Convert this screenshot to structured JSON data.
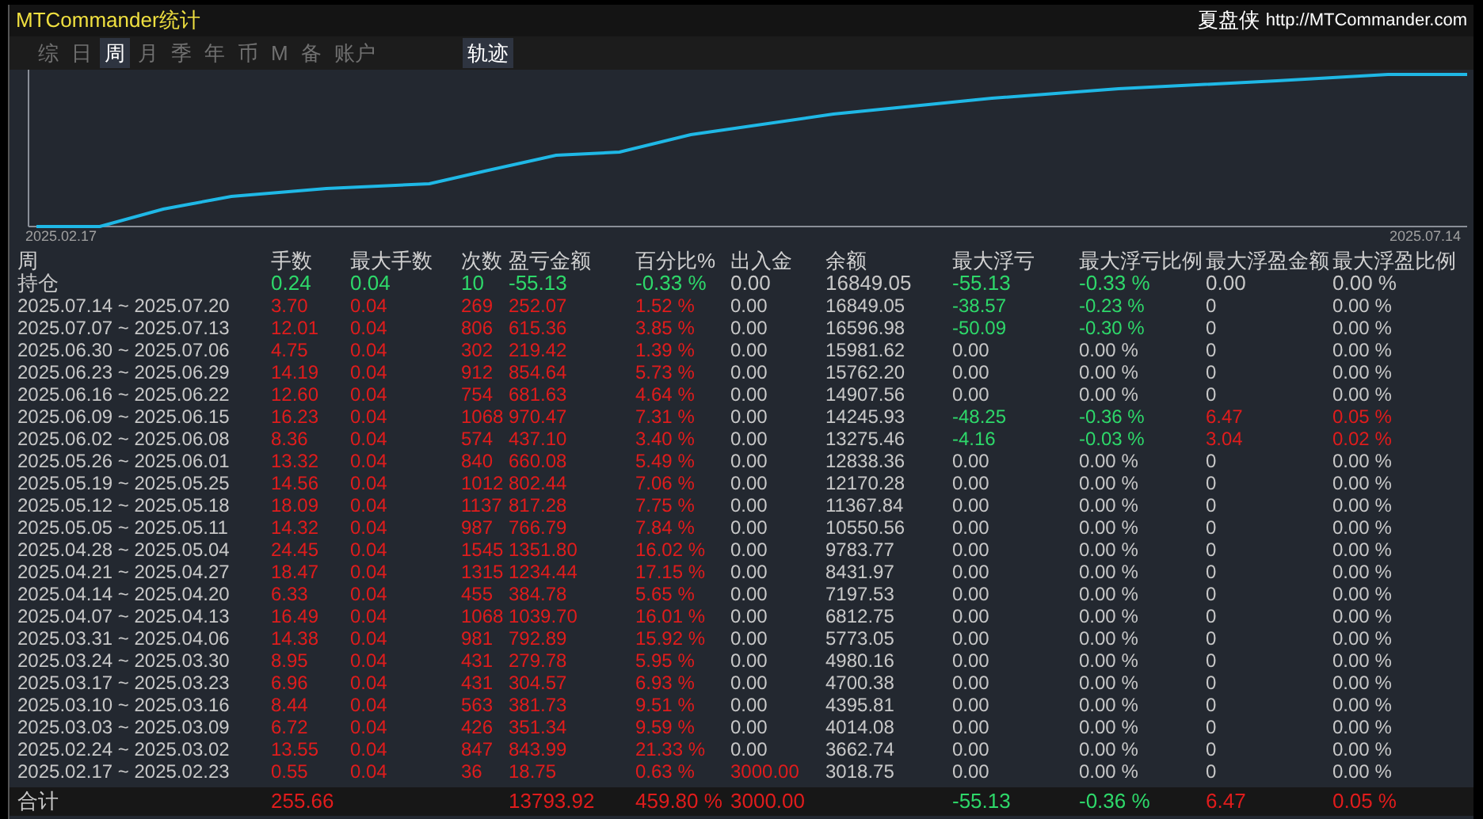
{
  "title": "MTCommander统计",
  "brand": {
    "name": "夏盘侠",
    "url": "http://MTCommander.com"
  },
  "tabs": [
    {
      "label": "综",
      "selected": false
    },
    {
      "label": "日",
      "selected": false
    },
    {
      "label": "周",
      "selected": true
    },
    {
      "label": "月",
      "selected": false
    },
    {
      "label": "季",
      "selected": false
    },
    {
      "label": "年",
      "selected": false
    },
    {
      "label": "币",
      "selected": false
    },
    {
      "label": "M",
      "selected": false
    },
    {
      "label": "备",
      "selected": false
    },
    {
      "label": "账户",
      "selected": false
    }
  ],
  "track_button": {
    "label": "轨迹",
    "on": true
  },
  "chart": {
    "start_label": "2025.02.17",
    "end_label": "2025.07.14"
  },
  "table": {
    "columns": [
      "周",
      "手数",
      "最大手数",
      "次数",
      "盈亏金额",
      "百分比%",
      "出入金",
      "余额",
      "最大浮亏",
      "最大浮亏比例",
      "最大浮盈金额",
      "最大浮盈比例"
    ],
    "rows": [
      [
        {
          "text": "持仓",
          "color": "#c8c8c8"
        },
        {
          "text": "0.24",
          "color": "#2ed86a"
        },
        {
          "text": "0.04",
          "color": "#2ed86a"
        },
        {
          "text": "10",
          "color": "#2ed86a"
        },
        {
          "text": "-55.13",
          "color": "#2ed86a"
        },
        {
          "text": "-0.33 %",
          "color": "#2ed86a"
        },
        {
          "text": "0.00",
          "color": "#c8c8c8"
        },
        {
          "text": "16849.05",
          "color": "#c8c8c8"
        },
        {
          "text": "-55.13",
          "color": "#2ed86a"
        },
        {
          "text": "-0.33 %",
          "color": "#2ed86a"
        },
        {
          "text": "0.00",
          "color": "#c8c8c8"
        },
        {
          "text": "0.00 %",
          "color": "#c8c8c8"
        }
      ],
      [
        {
          "text": "2025.07.14 ~ 2025.07.20",
          "color": "#c8c8c8"
        },
        {
          "text": "3.70",
          "color": "#e01c1c"
        },
        {
          "text": "0.04",
          "color": "#e01c1c"
        },
        {
          "text": "269",
          "color": "#e01c1c"
        },
        {
          "text": "252.07",
          "color": "#e01c1c"
        },
        {
          "text": "1.52 %",
          "color": "#e01c1c"
        },
        {
          "text": "0.00",
          "color": "#c8c8c8"
        },
        {
          "text": "16849.05",
          "color": "#c8c8c8"
        },
        {
          "text": "-38.57",
          "color": "#2ed86a"
        },
        {
          "text": "-0.23 %",
          "color": "#2ed86a"
        },
        {
          "text": "0",
          "color": "#c8c8c8"
        },
        {
          "text": "0.00 %",
          "color": "#c8c8c8"
        }
      ],
      [
        {
          "text": "2025.07.07 ~ 2025.07.13",
          "color": "#c8c8c8"
        },
        {
          "text": "12.01",
          "color": "#e01c1c"
        },
        {
          "text": "0.04",
          "color": "#e01c1c"
        },
        {
          "text": "806",
          "color": "#e01c1c"
        },
        {
          "text": "615.36",
          "color": "#e01c1c"
        },
        {
          "text": "3.85 %",
          "color": "#e01c1c"
        },
        {
          "text": "0.00",
          "color": "#c8c8c8"
        },
        {
          "text": "16596.98",
          "color": "#c8c8c8"
        },
        {
          "text": "-50.09",
          "color": "#2ed86a"
        },
        {
          "text": "-0.30 %",
          "color": "#2ed86a"
        },
        {
          "text": "0",
          "color": "#c8c8c8"
        },
        {
          "text": "0.00 %",
          "color": "#c8c8c8"
        }
      ],
      [
        {
          "text": "2025.06.30 ~ 2025.07.06",
          "color": "#c8c8c8"
        },
        {
          "text": "4.75",
          "color": "#e01c1c"
        },
        {
          "text": "0.04",
          "color": "#e01c1c"
        },
        {
          "text": "302",
          "color": "#e01c1c"
        },
        {
          "text": "219.42",
          "color": "#e01c1c"
        },
        {
          "text": "1.39 %",
          "color": "#e01c1c"
        },
        {
          "text": "0.00",
          "color": "#c8c8c8"
        },
        {
          "text": "15981.62",
          "color": "#c8c8c8"
        },
        {
          "text": "0.00",
          "color": "#c8c8c8"
        },
        {
          "text": "0.00 %",
          "color": "#c8c8c8"
        },
        {
          "text": "0",
          "color": "#c8c8c8"
        },
        {
          "text": "0.00 %",
          "color": "#c8c8c8"
        }
      ],
      [
        {
          "text": "2025.06.23 ~ 2025.06.29",
          "color": "#c8c8c8"
        },
        {
          "text": "14.19",
          "color": "#e01c1c"
        },
        {
          "text": "0.04",
          "color": "#e01c1c"
        },
        {
          "text": "912",
          "color": "#e01c1c"
        },
        {
          "text": "854.64",
          "color": "#e01c1c"
        },
        {
          "text": "5.73 %",
          "color": "#e01c1c"
        },
        {
          "text": "0.00",
          "color": "#c8c8c8"
        },
        {
          "text": "15762.20",
          "color": "#c8c8c8"
        },
        {
          "text": "0.00",
          "color": "#c8c8c8"
        },
        {
          "text": "0.00 %",
          "color": "#c8c8c8"
        },
        {
          "text": "0",
          "color": "#c8c8c8"
        },
        {
          "text": "0.00 %",
          "color": "#c8c8c8"
        }
      ],
      [
        {
          "text": "2025.06.16 ~ 2025.06.22",
          "color": "#c8c8c8"
        },
        {
          "text": "12.60",
          "color": "#e01c1c"
        },
        {
          "text": "0.04",
          "color": "#e01c1c"
        },
        {
          "text": "754",
          "color": "#e01c1c"
        },
        {
          "text": "681.63",
          "color": "#e01c1c"
        },
        {
          "text": "4.64 %",
          "color": "#e01c1c"
        },
        {
          "text": "0.00",
          "color": "#c8c8c8"
        },
        {
          "text": "14907.56",
          "color": "#c8c8c8"
        },
        {
          "text": "0.00",
          "color": "#c8c8c8"
        },
        {
          "text": "0.00 %",
          "color": "#c8c8c8"
        },
        {
          "text": "0",
          "color": "#c8c8c8"
        },
        {
          "text": "0.00 %",
          "color": "#c8c8c8"
        }
      ],
      [
        {
          "text": "2025.06.09 ~ 2025.06.15",
          "color": "#c8c8c8"
        },
        {
          "text": "16.23",
          "color": "#e01c1c"
        },
        {
          "text": "0.04",
          "color": "#e01c1c"
        },
        {
          "text": "1068",
          "color": "#e01c1c"
        },
        {
          "text": "970.47",
          "color": "#e01c1c"
        },
        {
          "text": "7.31 %",
          "color": "#e01c1c"
        },
        {
          "text": "0.00",
          "color": "#c8c8c8"
        },
        {
          "text": "14245.93",
          "color": "#c8c8c8"
        },
        {
          "text": "-48.25",
          "color": "#2ed86a"
        },
        {
          "text": "-0.36 %",
          "color": "#2ed86a"
        },
        {
          "text": "6.47",
          "color": "#e01c1c"
        },
        {
          "text": "0.05 %",
          "color": "#e01c1c"
        }
      ],
      [
        {
          "text": "2025.06.02 ~ 2025.06.08",
          "color": "#c8c8c8"
        },
        {
          "text": "8.36",
          "color": "#e01c1c"
        },
        {
          "text": "0.04",
          "color": "#e01c1c"
        },
        {
          "text": "574",
          "color": "#e01c1c"
        },
        {
          "text": "437.10",
          "color": "#e01c1c"
        },
        {
          "text": "3.40 %",
          "color": "#e01c1c"
        },
        {
          "text": "0.00",
          "color": "#c8c8c8"
        },
        {
          "text": "13275.46",
          "color": "#c8c8c8"
        },
        {
          "text": "-4.16",
          "color": "#2ed86a"
        },
        {
          "text": "-0.03 %",
          "color": "#2ed86a"
        },
        {
          "text": "3.04",
          "color": "#e01c1c"
        },
        {
          "text": "0.02 %",
          "color": "#e01c1c"
        }
      ],
      [
        {
          "text": "2025.05.26 ~ 2025.06.01",
          "color": "#c8c8c8"
        },
        {
          "text": "13.32",
          "color": "#e01c1c"
        },
        {
          "text": "0.04",
          "color": "#e01c1c"
        },
        {
          "text": "840",
          "color": "#e01c1c"
        },
        {
          "text": "660.08",
          "color": "#e01c1c"
        },
        {
          "text": "5.49 %",
          "color": "#e01c1c"
        },
        {
          "text": "0.00",
          "color": "#c8c8c8"
        },
        {
          "text": "12838.36",
          "color": "#c8c8c8"
        },
        {
          "text": "0.00",
          "color": "#c8c8c8"
        },
        {
          "text": "0.00 %",
          "color": "#c8c8c8"
        },
        {
          "text": "0",
          "color": "#c8c8c8"
        },
        {
          "text": "0.00 %",
          "color": "#c8c8c8"
        }
      ],
      [
        {
          "text": "2025.05.19 ~ 2025.05.25",
          "color": "#c8c8c8"
        },
        {
          "text": "14.56",
          "color": "#e01c1c"
        },
        {
          "text": "0.04",
          "color": "#e01c1c"
        },
        {
          "text": "1012",
          "color": "#e01c1c"
        },
        {
          "text": "802.44",
          "color": "#e01c1c"
        },
        {
          "text": "7.06 %",
          "color": "#e01c1c"
        },
        {
          "text": "0.00",
          "color": "#c8c8c8"
        },
        {
          "text": "12170.28",
          "color": "#c8c8c8"
        },
        {
          "text": "0.00",
          "color": "#c8c8c8"
        },
        {
          "text": "0.00 %",
          "color": "#c8c8c8"
        },
        {
          "text": "0",
          "color": "#c8c8c8"
        },
        {
          "text": "0.00 %",
          "color": "#c8c8c8"
        }
      ],
      [
        {
          "text": "2025.05.12 ~ 2025.05.18",
          "color": "#c8c8c8"
        },
        {
          "text": "18.09",
          "color": "#e01c1c"
        },
        {
          "text": "0.04",
          "color": "#e01c1c"
        },
        {
          "text": "1137",
          "color": "#e01c1c"
        },
        {
          "text": "817.28",
          "color": "#e01c1c"
        },
        {
          "text": "7.75 %",
          "color": "#e01c1c"
        },
        {
          "text": "0.00",
          "color": "#c8c8c8"
        },
        {
          "text": "11367.84",
          "color": "#c8c8c8"
        },
        {
          "text": "0.00",
          "color": "#c8c8c8"
        },
        {
          "text": "0.00 %",
          "color": "#c8c8c8"
        },
        {
          "text": "0",
          "color": "#c8c8c8"
        },
        {
          "text": "0.00 %",
          "color": "#c8c8c8"
        }
      ],
      [
        {
          "text": "2025.05.05 ~ 2025.05.11",
          "color": "#c8c8c8"
        },
        {
          "text": "14.32",
          "color": "#e01c1c"
        },
        {
          "text": "0.04",
          "color": "#e01c1c"
        },
        {
          "text": "987",
          "color": "#e01c1c"
        },
        {
          "text": "766.79",
          "color": "#e01c1c"
        },
        {
          "text": "7.84 %",
          "color": "#e01c1c"
        },
        {
          "text": "0.00",
          "color": "#c8c8c8"
        },
        {
          "text": "10550.56",
          "color": "#c8c8c8"
        },
        {
          "text": "0.00",
          "color": "#c8c8c8"
        },
        {
          "text": "0.00 %",
          "color": "#c8c8c8"
        },
        {
          "text": "0",
          "color": "#c8c8c8"
        },
        {
          "text": "0.00 %",
          "color": "#c8c8c8"
        }
      ],
      [
        {
          "text": "2025.04.28 ~ 2025.05.04",
          "color": "#c8c8c8"
        },
        {
          "text": "24.45",
          "color": "#e01c1c"
        },
        {
          "text": "0.04",
          "color": "#e01c1c"
        },
        {
          "text": "1545",
          "color": "#e01c1c"
        },
        {
          "text": "1351.80",
          "color": "#e01c1c"
        },
        {
          "text": "16.02 %",
          "color": "#e01c1c"
        },
        {
          "text": "0.00",
          "color": "#c8c8c8"
        },
        {
          "text": "9783.77",
          "color": "#c8c8c8"
        },
        {
          "text": "0.00",
          "color": "#c8c8c8"
        },
        {
          "text": "0.00 %",
          "color": "#c8c8c8"
        },
        {
          "text": "0",
          "color": "#c8c8c8"
        },
        {
          "text": "0.00 %",
          "color": "#c8c8c8"
        }
      ],
      [
        {
          "text": "2025.04.21 ~ 2025.04.27",
          "color": "#c8c8c8"
        },
        {
          "text": "18.47",
          "color": "#e01c1c"
        },
        {
          "text": "0.04",
          "color": "#e01c1c"
        },
        {
          "text": "1315",
          "color": "#e01c1c"
        },
        {
          "text": "1234.44",
          "color": "#e01c1c"
        },
        {
          "text": "17.15 %",
          "color": "#e01c1c"
        },
        {
          "text": "0.00",
          "color": "#c8c8c8"
        },
        {
          "text": "8431.97",
          "color": "#c8c8c8"
        },
        {
          "text": "0.00",
          "color": "#c8c8c8"
        },
        {
          "text": "0.00 %",
          "color": "#c8c8c8"
        },
        {
          "text": "0",
          "color": "#c8c8c8"
        },
        {
          "text": "0.00 %",
          "color": "#c8c8c8"
        }
      ],
      [
        {
          "text": "2025.04.14 ~ 2025.04.20",
          "color": "#c8c8c8"
        },
        {
          "text": "6.33",
          "color": "#e01c1c"
        },
        {
          "text": "0.04",
          "color": "#e01c1c"
        },
        {
          "text": "455",
          "color": "#e01c1c"
        },
        {
          "text": "384.78",
          "color": "#e01c1c"
        },
        {
          "text": "5.65 %",
          "color": "#e01c1c"
        },
        {
          "text": "0.00",
          "color": "#c8c8c8"
        },
        {
          "text": "7197.53",
          "color": "#c8c8c8"
        },
        {
          "text": "0.00",
          "color": "#c8c8c8"
        },
        {
          "text": "0.00 %",
          "color": "#c8c8c8"
        },
        {
          "text": "0",
          "color": "#c8c8c8"
        },
        {
          "text": "0.00 %",
          "color": "#c8c8c8"
        }
      ],
      [
        {
          "text": "2025.04.07 ~ 2025.04.13",
          "color": "#c8c8c8"
        },
        {
          "text": "16.49",
          "color": "#e01c1c"
        },
        {
          "text": "0.04",
          "color": "#e01c1c"
        },
        {
          "text": "1068",
          "color": "#e01c1c"
        },
        {
          "text": "1039.70",
          "color": "#e01c1c"
        },
        {
          "text": "16.01 %",
          "color": "#e01c1c"
        },
        {
          "text": "0.00",
          "color": "#c8c8c8"
        },
        {
          "text": "6812.75",
          "color": "#c8c8c8"
        },
        {
          "text": "0.00",
          "color": "#c8c8c8"
        },
        {
          "text": "0.00 %",
          "color": "#c8c8c8"
        },
        {
          "text": "0",
          "color": "#c8c8c8"
        },
        {
          "text": "0.00 %",
          "color": "#c8c8c8"
        }
      ],
      [
        {
          "text": "2025.03.31 ~ 2025.04.06",
          "color": "#c8c8c8"
        },
        {
          "text": "14.38",
          "color": "#e01c1c"
        },
        {
          "text": "0.04",
          "color": "#e01c1c"
        },
        {
          "text": "981",
          "color": "#e01c1c"
        },
        {
          "text": "792.89",
          "color": "#e01c1c"
        },
        {
          "text": "15.92 %",
          "color": "#e01c1c"
        },
        {
          "text": "0.00",
          "color": "#c8c8c8"
        },
        {
          "text": "5773.05",
          "color": "#c8c8c8"
        },
        {
          "text": "0.00",
          "color": "#c8c8c8"
        },
        {
          "text": "0.00 %",
          "color": "#c8c8c8"
        },
        {
          "text": "0",
          "color": "#c8c8c8"
        },
        {
          "text": "0.00 %",
          "color": "#c8c8c8"
        }
      ],
      [
        {
          "text": "2025.03.24 ~ 2025.03.30",
          "color": "#c8c8c8"
        },
        {
          "text": "8.95",
          "color": "#e01c1c"
        },
        {
          "text": "0.04",
          "color": "#e01c1c"
        },
        {
          "text": "431",
          "color": "#e01c1c"
        },
        {
          "text": "279.78",
          "color": "#e01c1c"
        },
        {
          "text": "5.95 %",
          "color": "#e01c1c"
        },
        {
          "text": "0.00",
          "color": "#c8c8c8"
        },
        {
          "text": "4980.16",
          "color": "#c8c8c8"
        },
        {
          "text": "0.00",
          "color": "#c8c8c8"
        },
        {
          "text": "0.00 %",
          "color": "#c8c8c8"
        },
        {
          "text": "0",
          "color": "#c8c8c8"
        },
        {
          "text": "0.00 %",
          "color": "#c8c8c8"
        }
      ],
      [
        {
          "text": "2025.03.17 ~ 2025.03.23",
          "color": "#c8c8c8"
        },
        {
          "text": "6.96",
          "color": "#e01c1c"
        },
        {
          "text": "0.04",
          "color": "#e01c1c"
        },
        {
          "text": "431",
          "color": "#e01c1c"
        },
        {
          "text": "304.57",
          "color": "#e01c1c"
        },
        {
          "text": "6.93 %",
          "color": "#e01c1c"
        },
        {
          "text": "0.00",
          "color": "#c8c8c8"
        },
        {
          "text": "4700.38",
          "color": "#c8c8c8"
        },
        {
          "text": "0.00",
          "color": "#c8c8c8"
        },
        {
          "text": "0.00 %",
          "color": "#c8c8c8"
        },
        {
          "text": "0",
          "color": "#c8c8c8"
        },
        {
          "text": "0.00 %",
          "color": "#c8c8c8"
        }
      ],
      [
        {
          "text": "2025.03.10 ~ 2025.03.16",
          "color": "#c8c8c8"
        },
        {
          "text": "8.44",
          "color": "#e01c1c"
        },
        {
          "text": "0.04",
          "color": "#e01c1c"
        },
        {
          "text": "563",
          "color": "#e01c1c"
        },
        {
          "text": "381.73",
          "color": "#e01c1c"
        },
        {
          "text": "9.51 %",
          "color": "#e01c1c"
        },
        {
          "text": "0.00",
          "color": "#c8c8c8"
        },
        {
          "text": "4395.81",
          "color": "#c8c8c8"
        },
        {
          "text": "0.00",
          "color": "#c8c8c8"
        },
        {
          "text": "0.00 %",
          "color": "#c8c8c8"
        },
        {
          "text": "0",
          "color": "#c8c8c8"
        },
        {
          "text": "0.00 %",
          "color": "#c8c8c8"
        }
      ],
      [
        {
          "text": "2025.03.03 ~ 2025.03.09",
          "color": "#c8c8c8"
        },
        {
          "text": "6.72",
          "color": "#e01c1c"
        },
        {
          "text": "0.04",
          "color": "#e01c1c"
        },
        {
          "text": "426",
          "color": "#e01c1c"
        },
        {
          "text": "351.34",
          "color": "#e01c1c"
        },
        {
          "text": "9.59 %",
          "color": "#e01c1c"
        },
        {
          "text": "0.00",
          "color": "#c8c8c8"
        },
        {
          "text": "4014.08",
          "color": "#c8c8c8"
        },
        {
          "text": "0.00",
          "color": "#c8c8c8"
        },
        {
          "text": "0.00 %",
          "color": "#c8c8c8"
        },
        {
          "text": "0",
          "color": "#c8c8c8"
        },
        {
          "text": "0.00 %",
          "color": "#c8c8c8"
        }
      ],
      [
        {
          "text": "2025.02.24 ~ 2025.03.02",
          "color": "#c8c8c8"
        },
        {
          "text": "13.55",
          "color": "#e01c1c"
        },
        {
          "text": "0.04",
          "color": "#e01c1c"
        },
        {
          "text": "847",
          "color": "#e01c1c"
        },
        {
          "text": "843.99",
          "color": "#e01c1c"
        },
        {
          "text": "21.33 %",
          "color": "#e01c1c"
        },
        {
          "text": "0.00",
          "color": "#c8c8c8"
        },
        {
          "text": "3662.74",
          "color": "#c8c8c8"
        },
        {
          "text": "0.00",
          "color": "#c8c8c8"
        },
        {
          "text": "0.00 %",
          "color": "#c8c8c8"
        },
        {
          "text": "0",
          "color": "#c8c8c8"
        },
        {
          "text": "0.00 %",
          "color": "#c8c8c8"
        }
      ],
      [
        {
          "text": "2025.02.17 ~ 2025.02.23",
          "color": "#c8c8c8"
        },
        {
          "text": "0.55",
          "color": "#e01c1c"
        },
        {
          "text": "0.04",
          "color": "#e01c1c"
        },
        {
          "text": "36",
          "color": "#e01c1c"
        },
        {
          "text": "18.75",
          "color": "#e01c1c"
        },
        {
          "text": "0.63 %",
          "color": "#e01c1c"
        },
        {
          "text": "3000.00",
          "color": "#e01c1c"
        },
        {
          "text": "3018.75",
          "color": "#c8c8c8"
        },
        {
          "text": "0.00",
          "color": "#c8c8c8"
        },
        {
          "text": "0.00 %",
          "color": "#c8c8c8"
        },
        {
          "text": "0",
          "color": "#c8c8c8"
        },
        {
          "text": "0.00 %",
          "color": "#c8c8c8"
        }
      ]
    ],
    "total": {
      "label": {
        "text": "合计",
        "color": "#c8c8c8"
      },
      "lots": {
        "text": "255.66",
        "color": "#e01c1c"
      },
      "profit": {
        "text": "13793.92",
        "color": "#e01c1c"
      },
      "percent": {
        "text": "459.80 %",
        "color": "#e01c1c"
      },
      "deposit": {
        "text": "3000.00",
        "color": "#e01c1c"
      },
      "max_float_loss": {
        "text": "-55.13",
        "color": "#2ed86a"
      },
      "max_float_loss_pct": {
        "text": "-0.36 %",
        "color": "#2ed86a"
      },
      "max_float_profit": {
        "text": "6.47",
        "color": "#e01c1c"
      },
      "max_float_profit_pct": {
        "text": "0.05 %",
        "color": "#e01c1c"
      }
    }
  }
}
